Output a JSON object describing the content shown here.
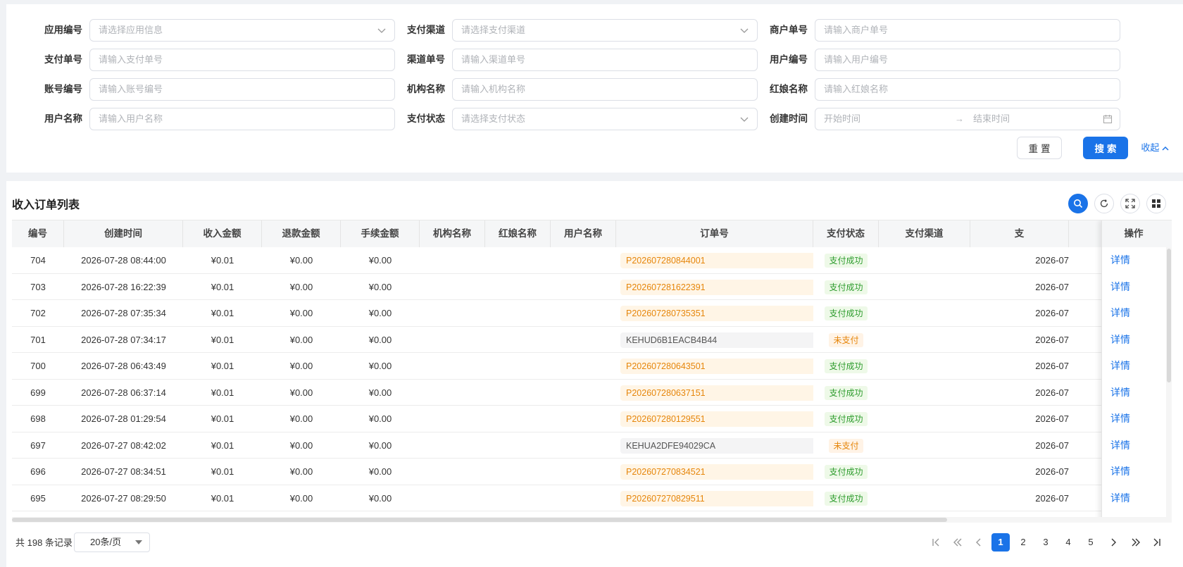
{
  "filters": {
    "row1": [
      {
        "label": "应用编号",
        "placeholder": "请选择应用信息",
        "type": "select"
      },
      {
        "label": "支付渠道",
        "placeholder": "请选择支付渠道",
        "type": "select"
      },
      {
        "label": "商户单号",
        "placeholder": "请输入商户单号",
        "type": "text"
      }
    ],
    "row2": [
      {
        "label": "支付单号",
        "placeholder": "请输入支付单号",
        "type": "text"
      },
      {
        "label": "渠道单号",
        "placeholder": "请输入渠道单号",
        "type": "text"
      },
      {
        "label": "用户编号",
        "placeholder": "请输入用户编号",
        "type": "text"
      }
    ],
    "row3": [
      {
        "label": "账号编号",
        "placeholder": "请输入账号编号",
        "type": "text"
      },
      {
        "label": "机构名称",
        "placeholder": "请输入机构名称",
        "type": "text"
      },
      {
        "label": "红娘名称",
        "placeholder": "请输入红娘名称",
        "type": "text"
      }
    ],
    "row4": [
      {
        "label": "用户名称",
        "placeholder": "请输入用户名称",
        "type": "text"
      },
      {
        "label": "支付状态",
        "placeholder": "请选择支付状态",
        "type": "select"
      },
      {
        "label": "创建时间",
        "start_placeholder": "开始时间",
        "separator": "→",
        "end_placeholder": "结束时间",
        "type": "daterange"
      }
    ],
    "actions": {
      "reset_label": "重置",
      "search_label": "搜索",
      "collapse_label": "收起"
    }
  },
  "table": {
    "title": "收入订单列表",
    "columns": [
      "编号",
      "创建时间",
      "收入金额",
      "退款金额",
      "手续金额",
      "机构名称",
      "红娘名称",
      "用户名称",
      "订单号",
      "支付状态",
      "支付渠道",
      "支"
    ],
    "action_column": "操作",
    "action_label": "详情",
    "rows": [
      {
        "id": "704",
        "created": "2026-07-28 08:44:00",
        "income": "¥0.01",
        "refund": "¥0.00",
        "fee": "¥0.00",
        "org": "",
        "matchmaker": "",
        "user": "",
        "order_no": "P202607280844001",
        "status": "支付成功",
        "status_type": "ok",
        "channel": "",
        "pay_time": "2026-07"
      },
      {
        "id": "703",
        "created": "2026-07-28 16:22:39",
        "income": "¥0.01",
        "refund": "¥0.00",
        "fee": "¥0.00",
        "org": "",
        "matchmaker": "",
        "user": "",
        "order_no": "P202607281622391",
        "status": "支付成功",
        "status_type": "ok",
        "channel": "",
        "pay_time": "2026-07"
      },
      {
        "id": "702",
        "created": "2026-07-28 07:35:34",
        "income": "¥0.01",
        "refund": "¥0.00",
        "fee": "¥0.00",
        "org": "",
        "matchmaker": "",
        "user": "",
        "order_no": "P202607280735351",
        "status": "支付成功",
        "status_type": "ok",
        "channel": "",
        "pay_time": "2026-07"
      },
      {
        "id": "701",
        "created": "2026-07-28 07:34:17",
        "income": "¥0.01",
        "refund": "¥0.00",
        "fee": "¥0.00",
        "org": "",
        "matchmaker": "",
        "user": "",
        "order_no": "KEHUD6B1EACB4B44",
        "status": "未支付",
        "status_type": "wait",
        "channel": "",
        "pay_time": "2026-07"
      },
      {
        "id": "700",
        "created": "2026-07-28 06:43:49",
        "income": "¥0.01",
        "refund": "¥0.00",
        "fee": "¥0.00",
        "org": "",
        "matchmaker": "",
        "user": "",
        "order_no": "P202607280643501",
        "status": "支付成功",
        "status_type": "ok",
        "channel": "",
        "pay_time": "2026-07"
      },
      {
        "id": "699",
        "created": "2026-07-28 06:37:14",
        "income": "¥0.01",
        "refund": "¥0.00",
        "fee": "¥0.00",
        "org": "",
        "matchmaker": "",
        "user": "",
        "order_no": "P202607280637151",
        "status": "支付成功",
        "status_type": "ok",
        "channel": "",
        "pay_time": "2026-07"
      },
      {
        "id": "698",
        "created": "2026-07-28 01:29:54",
        "income": "¥0.01",
        "refund": "¥0.00",
        "fee": "¥0.00",
        "org": "",
        "matchmaker": "",
        "user": "",
        "order_no": "P202607280129551",
        "status": "支付成功",
        "status_type": "ok",
        "channel": "",
        "pay_time": "2026-07"
      },
      {
        "id": "697",
        "created": "2026-07-27 08:42:02",
        "income": "¥0.01",
        "refund": "¥0.00",
        "fee": "¥0.00",
        "org": "",
        "matchmaker": "",
        "user": "",
        "order_no": "KEHUA2DFE94029CA",
        "status": "未支付",
        "status_type": "wait",
        "channel": "",
        "pay_time": "2026-07"
      },
      {
        "id": "696",
        "created": "2026-07-27 08:34:51",
        "income": "¥0.01",
        "refund": "¥0.00",
        "fee": "¥0.00",
        "org": "",
        "matchmaker": "",
        "user": "",
        "order_no": "P202607270834521",
        "status": "支付成功",
        "status_type": "ok",
        "channel": "",
        "pay_time": "2026-07"
      },
      {
        "id": "695",
        "created": "2026-07-27 08:29:50",
        "income": "¥0.01",
        "refund": "¥0.00",
        "fee": "¥0.00",
        "org": "",
        "matchmaker": "",
        "user": "",
        "order_no": "P202607270829511",
        "status": "支付成功",
        "status_type": "ok",
        "channel": "",
        "pay_time": "2026-07"
      }
    ]
  },
  "pagination": {
    "total_text": "共 198 条记录",
    "page_size": "20条/页",
    "pages": [
      "1",
      "2",
      "3",
      "4",
      "5"
    ],
    "current": "1"
  },
  "icons": {
    "toolbar": [
      "search-icon",
      "refresh-icon",
      "fullscreen-icon",
      "column-settings-icon"
    ],
    "pager": [
      "first-page-icon",
      "prev-group-icon",
      "prev-page-icon",
      "next-page-icon",
      "next-group-icon",
      "last-page-icon"
    ]
  },
  "colors": {
    "primary": "#1a73e8",
    "paid_order": "#e6860b",
    "success": "#2d9c2d",
    "pending": "#e6860b"
  }
}
